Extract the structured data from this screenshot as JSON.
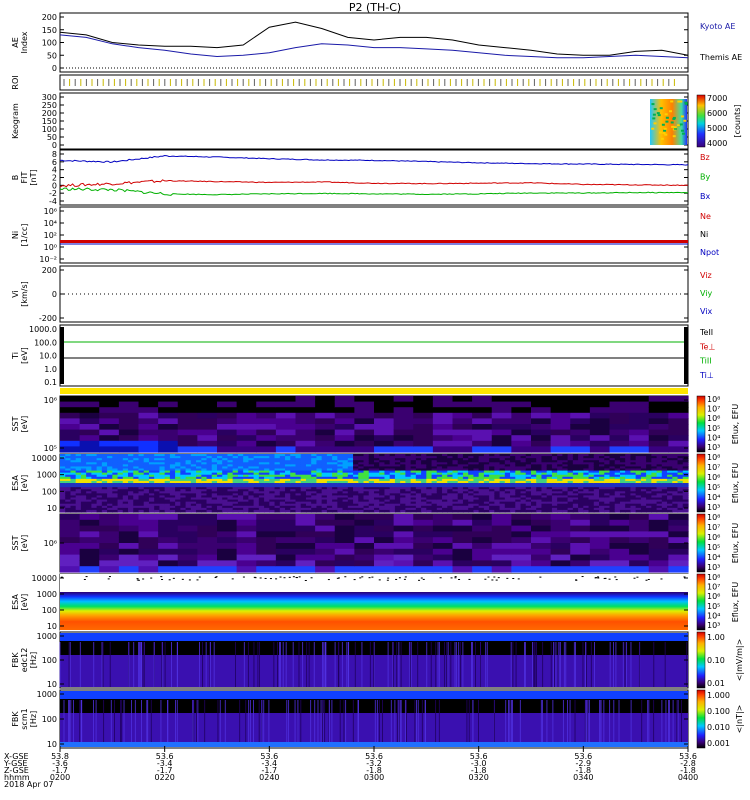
{
  "title": "P2 (TH-C)",
  "colors": {
    "kyoto": "#1a1aa8",
    "themis": "#000000",
    "red": "#d00000",
    "green": "#00b000",
    "blue": "#0000c0",
    "black": "#000000",
    "yellow": "#ffe600"
  },
  "time_axis": {
    "ticks": [
      "0200",
      "0220",
      "0240",
      "0300",
      "0320",
      "0340",
      "0400"
    ],
    "row_labels": [
      "X-GSE",
      "Y-GSE",
      "Z-GSE",
      "hhmm",
      "2018 Apr 07"
    ],
    "rows": [
      [
        "53.8",
        "53.6",
        "53.6",
        "53.6",
        "53.6",
        "53.6",
        "53.6"
      ],
      [
        "-3.6",
        "-3.4",
        "-3.4",
        "-3.2",
        "-3.0",
        "-2.9",
        "-2.8"
      ],
      [
        "-1.7",
        "-1.7",
        "-1.7",
        "-1.8",
        "-1.8",
        "-1.8",
        "-1.8"
      ]
    ]
  },
  "panels": {
    "ae": {
      "ylabel": "AE Index",
      "yticks": [
        "200",
        "150",
        "100",
        "50",
        "0"
      ],
      "legend": [
        "Kyoto AE",
        "Themis AE"
      ]
    },
    "roi": {
      "ylabel": "ROI"
    },
    "keogram": {
      "ylabel": "Keogram",
      "yticks": [
        "300",
        "250",
        "200",
        "150",
        "100",
        "50",
        "0"
      ],
      "cb_ticks": [
        "7000",
        "6000",
        "5000",
        "4000"
      ],
      "cb_label": "[counts]"
    },
    "bfield": {
      "ylabel": "B FIT [nT]",
      "yticks": [
        "8",
        "6",
        "4",
        "2",
        "0",
        "-2",
        "-4"
      ],
      "legend": [
        "Bz",
        "By",
        "Bx"
      ]
    },
    "density": {
      "ylabel": "Ni [1/cc]",
      "yticks": [
        "10⁶",
        "10⁴",
        "10²",
        "10⁰",
        "10⁻²"
      ],
      "legend": [
        "Ne",
        "Ni",
        "Npot"
      ]
    },
    "velocity": {
      "ylabel": "Vi [km/s]",
      "yticks": [
        "200",
        "0",
        "-200"
      ],
      "legend": [
        "Viz",
        "Viy",
        "Vix"
      ]
    },
    "temperature": {
      "ylabel": "Ti [eV]",
      "yticks": [
        "1000.0",
        "100.0",
        "10.0",
        "1.0",
        "0.1"
      ],
      "legend": [
        "TeII",
        "Te⊥",
        "TiII",
        "Ti⊥"
      ]
    },
    "sst_e": {
      "ylabel": "SST [eV]",
      "yticks": [
        "10⁶",
        "10⁵"
      ],
      "cb_label": "Eflux, EFU"
    },
    "esa_e": {
      "ylabel": "ESA [eV]",
      "yticks": [
        "10000",
        "1000",
        "100",
        "10"
      ],
      "cb_label": "Eflux, EFU"
    },
    "sst_i": {
      "ylabel": "SST [eV]",
      "yticks": [
        "10⁶"
      ],
      "cb_label": "Eflux, EFU"
    },
    "esa_i": {
      "ylabel": "ESA [eV]",
      "yticks": [
        "10000",
        "1000",
        "100",
        "10"
      ],
      "cb_label": "Eflux, EFU"
    },
    "fbk_e": {
      "ylabel": "FBK edc12 [Hz]",
      "yticks": [
        "1000",
        "100",
        "10"
      ],
      "cb_ticks": [
        "1.00",
        "0.10",
        "0.01"
      ],
      "cb_label": "<|mV/m|>"
    },
    "fbk_b": {
      "ylabel": "FBK scm1 [Hz]",
      "yticks": [
        "1000",
        "100",
        "10"
      ],
      "cb_ticks": [
        "1.000",
        "0.100",
        "0.010",
        "0.001"
      ],
      "cb_label": "<|nT|>"
    },
    "eflux_cb_ticks": [
      "10⁸",
      "10⁷",
      "10⁶",
      "10⁵",
      "10⁴",
      "10³"
    ]
  },
  "chart_data": [
    {
      "type": "line",
      "title": "P2 (TH-C)",
      "ylabel": "AE Index",
      "ylim": [
        0,
        200
      ],
      "x": [
        "0200",
        "0205",
        "0210",
        "0215",
        "0220",
        "0225",
        "0230",
        "0235",
        "0240",
        "0245",
        "0250",
        "0255",
        "0300",
        "0305",
        "0310",
        "0315",
        "0320",
        "0325",
        "0330",
        "0335",
        "0340",
        "0345",
        "0350",
        "0355",
        "0400"
      ],
      "series": [
        {
          "name": "Themis AE",
          "values": [
            140,
            130,
            100,
            90,
            85,
            85,
            80,
            90,
            160,
            180,
            155,
            120,
            110,
            120,
            120,
            110,
            90,
            80,
            70,
            55,
            50,
            50,
            65,
            70,
            50
          ]
        },
        {
          "name": "Kyoto AE",
          "values": [
            130,
            120,
            95,
            80,
            70,
            55,
            45,
            50,
            60,
            80,
            95,
            90,
            80,
            80,
            75,
            70,
            60,
            50,
            45,
            40,
            40,
            45,
            50,
            45,
            40
          ]
        }
      ]
    },
    {
      "type": "line",
      "ylabel": "B FIT [nT]",
      "ylim": [
        -4,
        8
      ],
      "x": [
        "0200",
        "0210",
        "0220",
        "0230",
        "0240",
        "0250",
        "0300",
        "0310",
        "0320",
        "0330",
        "0340",
        "0350",
        "0400"
      ],
      "series": [
        {
          "name": "Bz",
          "values": [
            6.2,
            5.8,
            7.3,
            7.0,
            6.6,
            6.3,
            6.2,
            5.9,
            5.6,
            5.4,
            5.3,
            5.2,
            5.1
          ]
        },
        {
          "name": "By",
          "values": [
            0.0,
            0.5,
            1.2,
            1.0,
            0.8,
            0.9,
            0.6,
            0.5,
            0.6,
            0.7,
            0.3,
            0.2,
            0.1
          ]
        },
        {
          "name": "Bx",
          "values": [
            -0.8,
            -1.0,
            -2.0,
            -2.2,
            -2.0,
            -1.9,
            -2.0,
            -2.1,
            -2.0,
            -1.8,
            -1.8,
            -1.7,
            -1.7
          ]
        }
      ]
    },
    {
      "type": "line",
      "ylabel": "Ti [eV]",
      "x": [
        "0200",
        "0400"
      ],
      "series": [
        {
          "name": "TeII",
          "values": [
            400,
            400
          ]
        },
        {
          "name": "TiII",
          "values": [
            12,
            12
          ]
        }
      ]
    }
  ]
}
